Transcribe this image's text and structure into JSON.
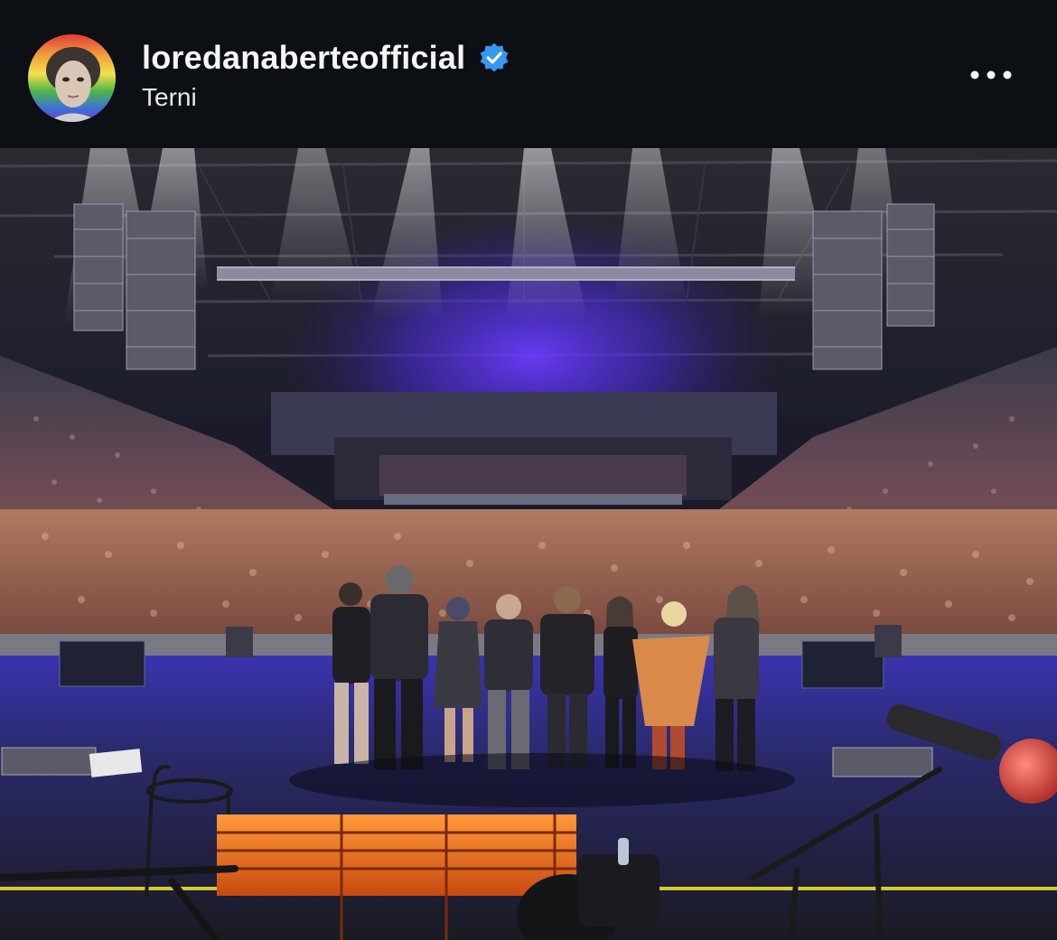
{
  "post": {
    "username": "loredanaberteofficial",
    "location": "Terni",
    "verified": true,
    "avatar_icon": "profile-avatar",
    "more_icon": "more-options-icon",
    "photo_icon": "concert-stage-photo"
  },
  "colors": {
    "header_bg": "#0c0f13",
    "verified_blue": "#3897f0",
    "text": "#f5f5f5",
    "stage_light": "#5a3cff"
  }
}
